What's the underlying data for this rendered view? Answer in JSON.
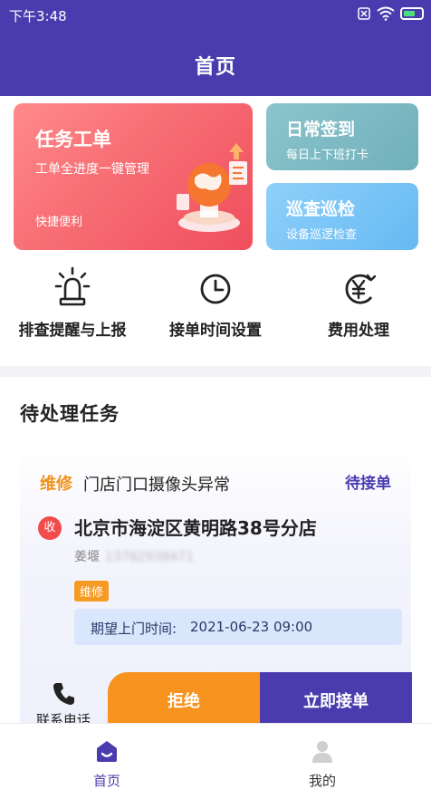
{
  "status_bar": {
    "time": "下午3:48"
  },
  "header": {
    "title": "首页"
  },
  "cards": {
    "work_order": {
      "title": "任务工单",
      "subtitle": "工单全进度一键管理",
      "footer": "快捷便利"
    },
    "checkin": {
      "title": "日常签到",
      "subtitle": "每日上下班打卡"
    },
    "patrol": {
      "title": "巡查巡检",
      "subtitle": "设备巡逻检查"
    }
  },
  "quick_actions": [
    {
      "label": "排查提醒与上报",
      "icon": "alarm-light-icon"
    },
    {
      "label": "接单时间设置",
      "icon": "clock-icon"
    },
    {
      "label": "费用处理",
      "icon": "yuan-icon"
    }
  ],
  "pending": {
    "section_title": "待处理任务",
    "task": {
      "type": "维修",
      "name": "门店门口摄像头异常",
      "status": "待接单",
      "receiver_badge": "收",
      "address": "北京市海淀区黄明路38号分店",
      "contact_name": "姜堰",
      "contact_phone": "13782938471",
      "tag": "维修",
      "expect_label": "期望上门时间:",
      "expect_time": "2021-06-23 09:00"
    },
    "actions": {
      "call_label": "联系电话",
      "reject_label": "拒绝",
      "accept_label": "立即接单"
    }
  },
  "tabbar": {
    "items": [
      {
        "label": "首页",
        "active": true,
        "icon": "home-icon"
      },
      {
        "label": "我的",
        "active": false,
        "icon": "profile-icon"
      }
    ]
  },
  "colors": {
    "primary": "#4a3cae",
    "orange": "#f7931e",
    "red": "#f04e5d"
  }
}
